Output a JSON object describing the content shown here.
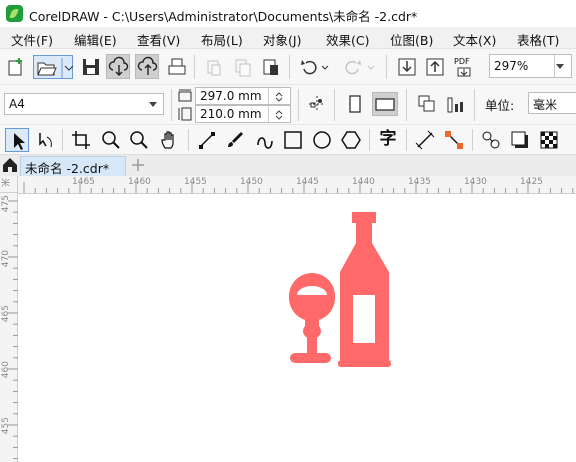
{
  "window": {
    "title": "CorelDRAW - C:\\Users\\Administrator\\Documents\\未命名 -2.cdr*"
  },
  "menu": [
    "文件(F)",
    "编辑(E)",
    "查看(V)",
    "布局(L)",
    "对象(J)",
    "效果(C)",
    "位图(B)",
    "文本(X)",
    "表格(T)"
  ],
  "toolbar": {
    "zoom_value": "297%",
    "pdf_label": "PDF"
  },
  "property_bar": {
    "page_size": "A4",
    "width_value": "297.0 mm",
    "height_value": "210.0 mm",
    "units_label": "单位:",
    "units_value": "毫米"
  },
  "toolbox": {
    "text_tool_glyph": "字"
  },
  "tabs": {
    "active_tab": "未命名 -2.cdr*"
  },
  "rulers": {
    "horizontal_labels": [
      "1465",
      "1460",
      "1455",
      "1450",
      "1445",
      "1440",
      "1435",
      "1430",
      "1425"
    ],
    "vertical_labels": [
      "475",
      "470",
      "465",
      "460",
      "455"
    ],
    "corner_label": "米"
  },
  "artwork": {
    "fill_color": "#ff6969"
  },
  "colors": {
    "accent": "#1f9d3a",
    "active_tab": "#d6e7f7"
  }
}
